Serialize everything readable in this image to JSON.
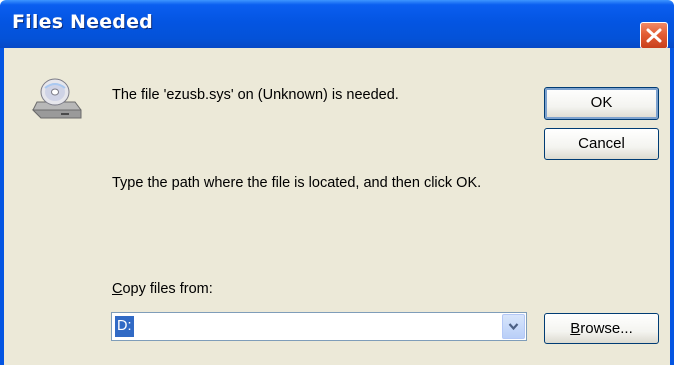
{
  "window": {
    "title": "Files Needed",
    "title_bar_color": "#0455e2",
    "close_icon": "close-icon"
  },
  "icon": {
    "name": "cd-drive-icon"
  },
  "message": {
    "line1": "The file 'ezusb.sys' on (Unknown) is needed.",
    "line2": "Type the path where the file is located, and then click OK."
  },
  "buttons": {
    "ok": "OK",
    "cancel": "Cancel",
    "browse_accel": "B",
    "browse_rest": "rowse..."
  },
  "copy_from": {
    "label_accel": "C",
    "label_rest": "opy files from:",
    "value": "D:",
    "dropdown_icon": "chevron-down-icon"
  }
}
